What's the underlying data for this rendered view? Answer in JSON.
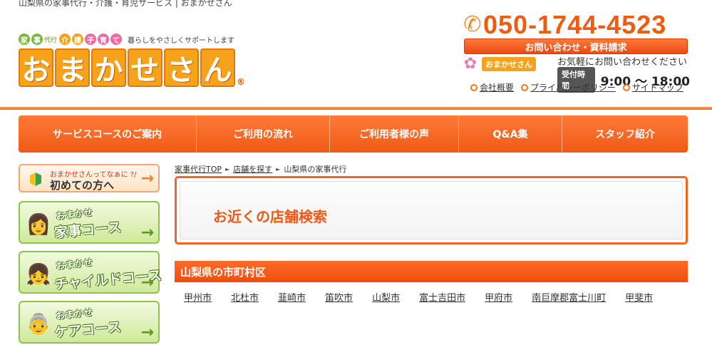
{
  "header": {
    "topline": "山梨県の家事代行・介護・育児サービス | おまかせさん",
    "logo": {
      "tags": [
        {
          "chars": [
            "家",
            "事"
          ],
          "label": "代行",
          "color": "#7ab83a"
        },
        {
          "chars": [
            "介"
          ],
          "label": "",
          "color": "#f6a21a"
        },
        {
          "chars": [
            "護"
          ],
          "label": "",
          "color": "#f6a21a"
        },
        {
          "chars": [
            "子"
          ],
          "label": "",
          "color": "#f06aa0"
        },
        {
          "chars": [
            "育"
          ],
          "label": "",
          "color": "#f06aa0"
        },
        {
          "chars": [
            "て"
          ],
          "label": "",
          "color": "#f06aa0"
        }
      ],
      "slogan": "暮らしをやさしくサポートします",
      "main_chars": [
        "お",
        "ま",
        "か",
        "せ",
        "さ",
        "ん"
      ],
      "registered": "®"
    },
    "contact": {
      "phone": "050-1744-4523",
      "inquiry_label": "お問い合わせ・資料請求",
      "mini_logo_text": "おまかせさん",
      "casual_text": "お気軽にお問い合わせください",
      "hours_label": "受付時間",
      "hours_value": "9:00 ～ 18:00",
      "links": [
        "会社概要",
        "プライバシーポリシー",
        "サイトマップ"
      ]
    }
  },
  "nav": {
    "items": [
      {
        "label": "サービスコースのご案内",
        "width": 250
      },
      {
        "label": "ご利用の流れ",
        "width": 187
      },
      {
        "label": "ご利用者様の声",
        "width": 181
      },
      {
        "label": "Q&A集",
        "width": 145
      },
      {
        "label": "スタッフ紹介",
        "width": 176
      }
    ]
  },
  "sidebar": {
    "first": {
      "small": "おまかせさんってなぁに ?/",
      "big": "初めての方へ"
    },
    "cards": [
      {
        "small": "おまかせ",
        "big": "家事コース",
        "avatar": "👩"
      },
      {
        "small": "おまかせ",
        "big": "チャイルドコース",
        "avatar": "👧"
      },
      {
        "small": "おまかせ",
        "big": "ケアコース",
        "avatar": "👵"
      }
    ]
  },
  "main": {
    "breadcrumb": {
      "items": [
        "家事代行TOP",
        "店舗を探す"
      ],
      "current": "山梨県の家事代行"
    },
    "search_title": "お近くの店舗検索",
    "region_title": "山梨県の市町村区",
    "cities": [
      "甲州市",
      "北杜市",
      "韮崎市",
      "笛吹市",
      "山梨市",
      "富士吉田市",
      "甲府市",
      "南巨摩郡富士川町",
      "甲斐市"
    ]
  },
  "colors": {
    "accent": "#f05a16",
    "green": "#8ec34a",
    "logo_orange": "#f6a21a"
  },
  "icons": {
    "phone": "phone-icon",
    "leaf": "beginner-leaf-icon",
    "arrow": "arrow-right-icon",
    "bullet": "circle-bullet-icon",
    "flower": "flower-icon"
  }
}
